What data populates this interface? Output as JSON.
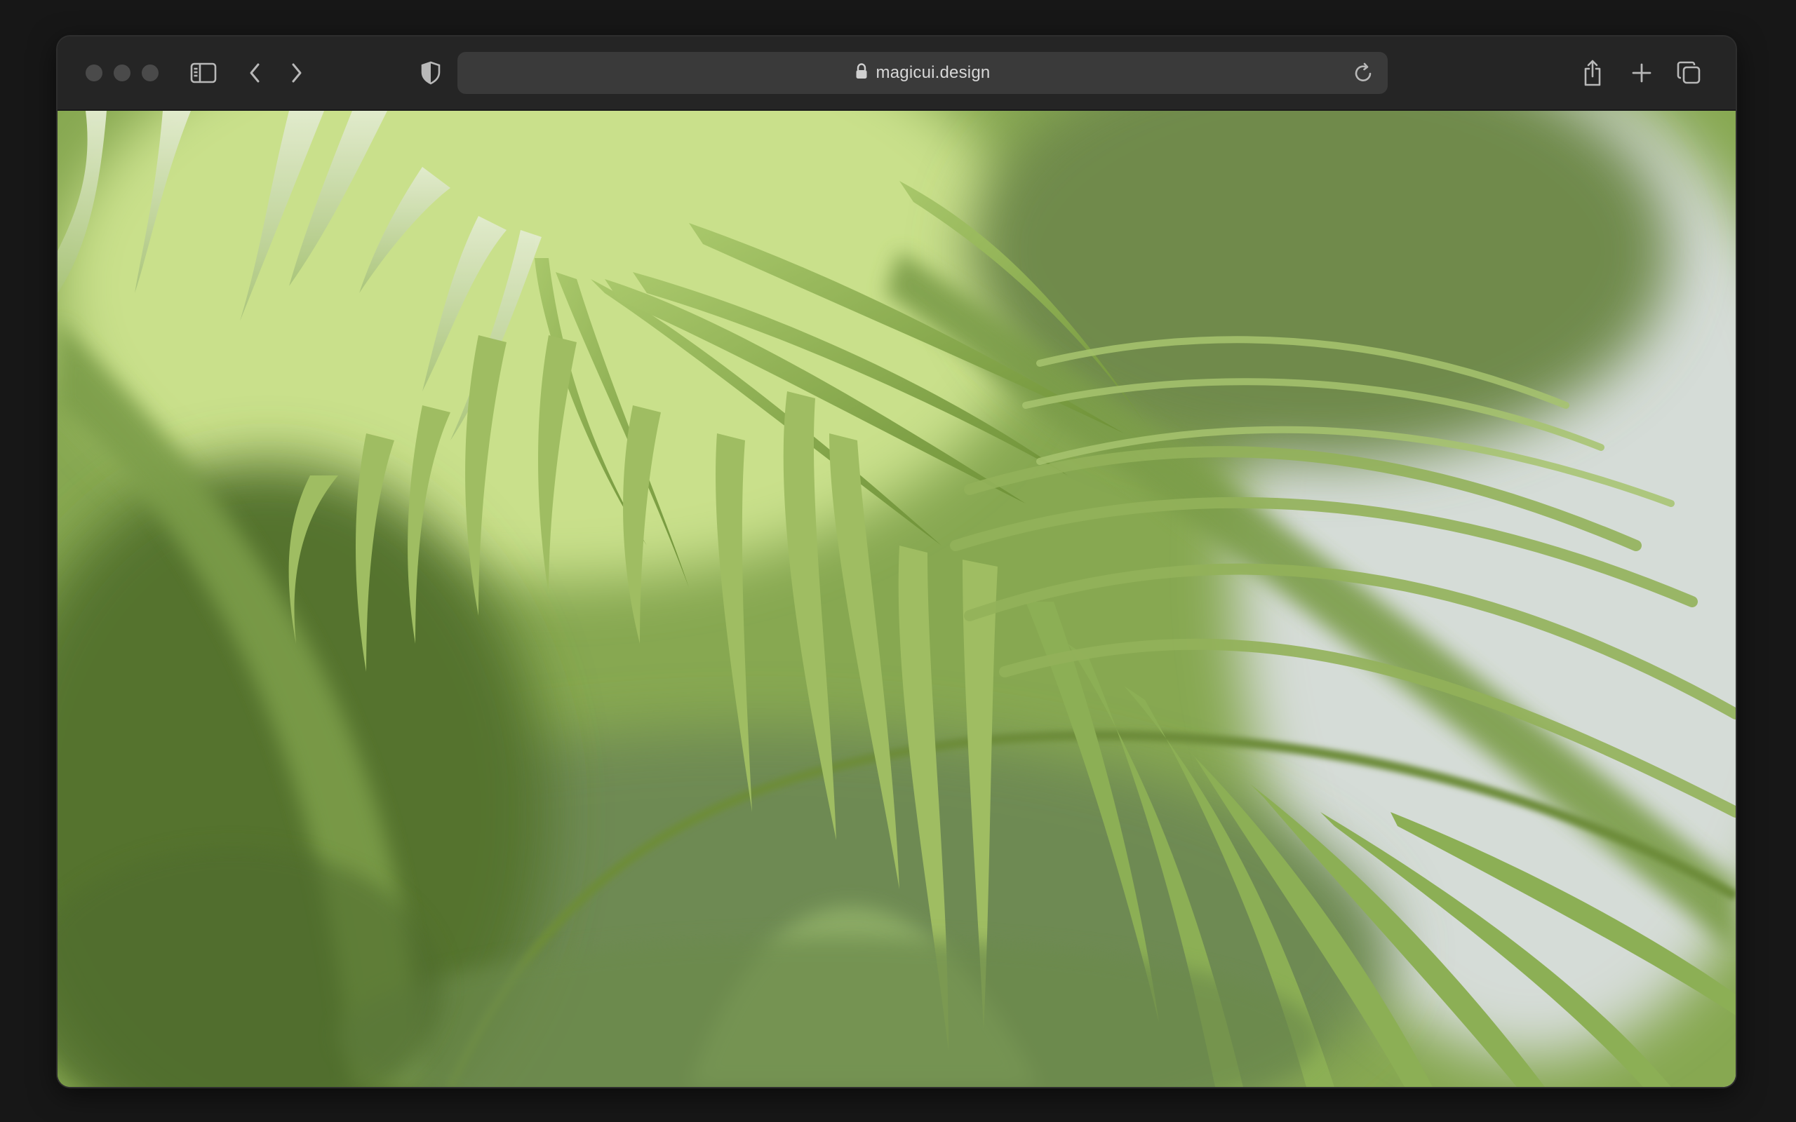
{
  "browser": {
    "url": "magicui.design",
    "icons": {
      "sidebar": "sidebar-icon",
      "back": "chevron-left-icon",
      "forward": "chevron-right-icon",
      "privacy": "shield-icon",
      "lock": "lock-icon",
      "reload": "reload-icon",
      "share": "share-icon",
      "new_tab": "plus-icon",
      "tabs": "tabs-overview-icon"
    }
  },
  "content": {
    "image": "palm-leaves-photo"
  },
  "colors": {
    "chrome_bg": "#252525",
    "url_bar": "#3a3a3a",
    "traffic_light": "#4a4a4a",
    "leaf_green": "#7fa146",
    "leaf_light": "#bcd48a",
    "background_wall": "#d0d8d3"
  }
}
